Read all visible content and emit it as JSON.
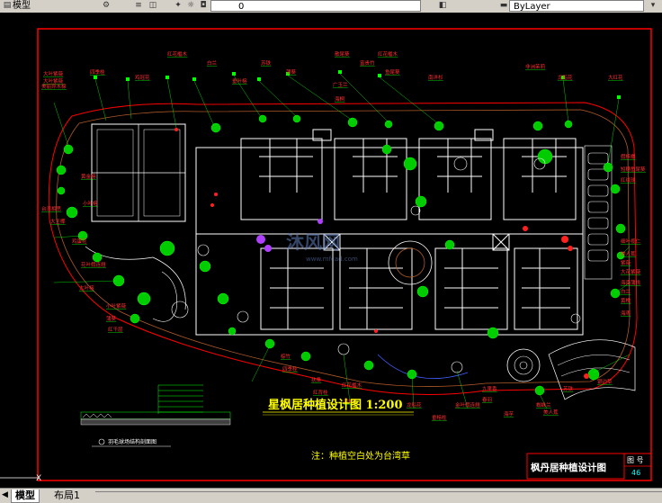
{
  "toolbar": {
    "layer_state_text": "0",
    "linetype_value": "ByLayer",
    "left_fragment": "模型"
  },
  "drawing": {
    "main_title": "星枫居种植设计图 1:200",
    "note": "注：种植空白处为台湾草",
    "title_block_name": "枫丹居种植设计图",
    "drawing_no_label": "图 号",
    "drawing_no": "46",
    "detail_caption": "羽毛球场结构剖面图",
    "watermark_text": "沐风网",
    "watermark_url": "www.mfcad.com",
    "plant_labels_top": [
      "大叶紫薇",
      "四季桂",
      "鸡冠花",
      "红花檵木",
      "白兰",
      "垂叶榕",
      "苏铁",
      "蒲葵",
      "散尾葵",
      "富贵竹",
      "鱼尾葵",
      "广玉兰",
      "海桐",
      "红花檵木",
      "南洋杉",
      "非洲茉莉",
      "龙船花",
      "大红花"
    ],
    "plant_labels_left": [
      "大叶紫薇",
      "美丽异木棉",
      "黄金榕",
      "小叶榕",
      "台湾相思",
      "大王椰",
      "鸡蛋花",
      "花叶假连翘",
      "大叶榕",
      "小叶紫薇",
      "蒲葵",
      "红千层"
    ],
    "plant_labels_right": [
      "假槟榔",
      "短穗鱼尾葵",
      "红绒球",
      "细叶榄仁",
      "美人蕉",
      "紫薇",
      "大花紫薇",
      "海南蒲桃",
      "白兰",
      "黄槐",
      "海枣"
    ],
    "plant_labels_bottom": [
      "棕竹",
      "四季桂",
      "扶桑",
      "红背桂",
      "红花檵木",
      "黄蝉",
      "龙船花",
      "垂榕柱",
      "金叶假连翘",
      "九里香",
      "春羽",
      "海芋",
      "蜘蛛兰",
      "美人蕉",
      "苏铁",
      "银边草"
    ]
  },
  "tabs": {
    "model_label": "模型",
    "layout1_label": "布局1"
  },
  "colors": {
    "canvas_bg": "#000000",
    "frame_red": "#ff0000",
    "building_white": "#ffffff",
    "plant_green": "#00ff00",
    "label_red": "#ff3030",
    "title_yellow": "#ffff00",
    "path_brown": "#b05a28",
    "title_cyan": "#00ffff"
  }
}
